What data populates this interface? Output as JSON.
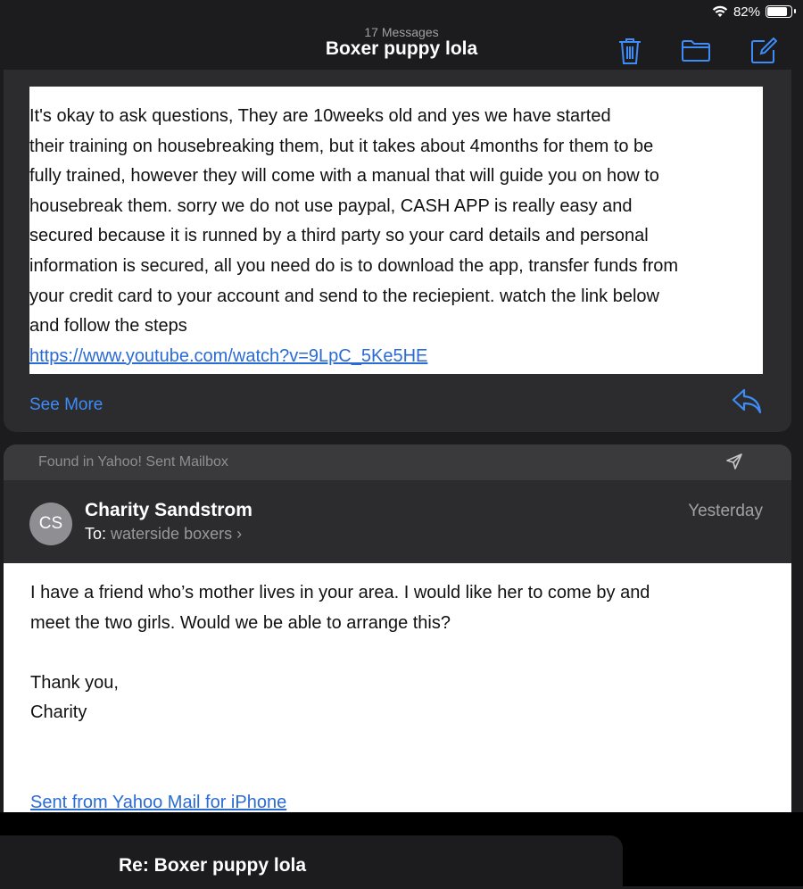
{
  "status_bar": {
    "battery": "82%",
    "battery_level": 0.82
  },
  "nav": {
    "message_count": "17 Messages",
    "title": "Boxer puppy lola",
    "icons": [
      "trash-icon",
      "folder-icon",
      "compose-icon"
    ]
  },
  "message1": {
    "lines": [
      "It's okay to ask questions, They are 10weeks old and yes we have started",
      "their training on housebreaking them, but it takes about 4months for them to be",
      "fully trained, however they will come with a manual that will guide you on how to",
      "housebreak them. sorry we do not use paypal, CASH APP is really easy and",
      "secured because it is runned by a third party so your card details and personal",
      "information is secured, all you need do is to download the app, transfer funds from",
      "your credit card to your account and send to the reciepient. watch the link below",
      "and follow the steps"
    ],
    "link": "https://www.youtube.com/watch?v=9LpC_5Ke5HE",
    "see_more": "See More"
  },
  "message2": {
    "found_in": "Found in Yahoo! Sent Mailbox",
    "avatar_initials": "CS",
    "sender": "Charity Sandstrom",
    "to_label": "To:",
    "to_value": "waterside boxers",
    "date": "Yesterday",
    "body_line1": "I have a friend who’s mother lives in your area.  I would like her to come by and",
    "body_line2": "meet the two girls.  Would we be able to arrange this?",
    "sign_off": "Thank you,",
    "signature": "Charity",
    "footer_link": "Sent from Yahoo Mail for iPhone"
  },
  "draft": {
    "title": "Re: Boxer puppy lola"
  },
  "colors": {
    "accent": "#3d8cf7",
    "link": "#2a6bd4",
    "background": "#1c1c1e",
    "card": "#2c2c2e"
  }
}
